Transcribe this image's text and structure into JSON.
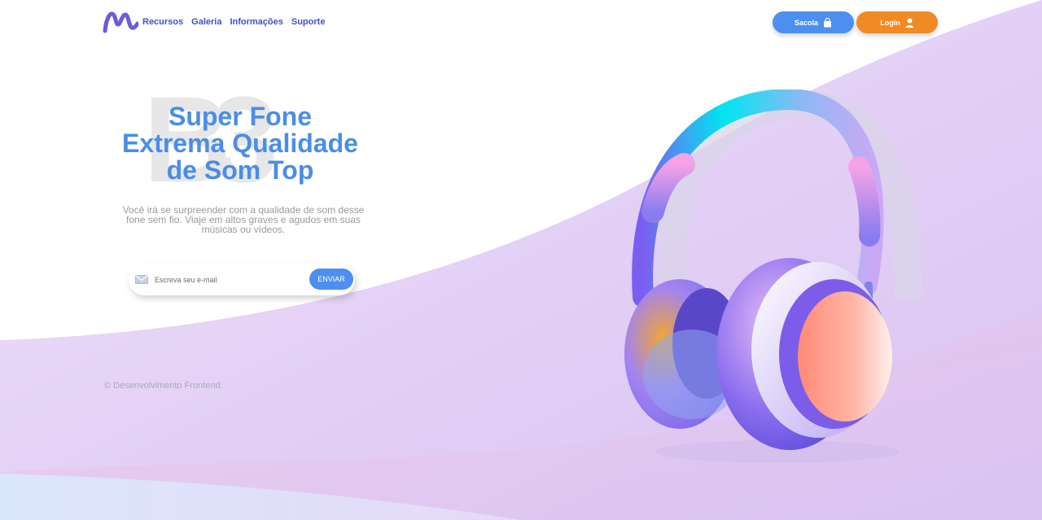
{
  "header": {
    "logo_label": "M",
    "nav": [
      {
        "label": "Recursos"
      },
      {
        "label": "Galeria"
      },
      {
        "label": "Informações"
      },
      {
        "label": "Suporte"
      }
    ],
    "bag_label": "Sacola",
    "login_label": "Login"
  },
  "hero": {
    "watermark": "B3",
    "title_lines": [
      "Super Fone",
      "Extrema Qualidade",
      "de Som Top"
    ],
    "description": "Você irá se surpreender com a qualidade de som desse fone sem fio. Viaje em altos graves e agudos em suas músicas ou vídeos."
  },
  "newsletter": {
    "placeholder": "Escreva seu e-mail",
    "value": "",
    "button_label": "ENVIAR"
  },
  "footer": {
    "text": "© Desenvolvimento Frontend."
  },
  "colors": {
    "accent_blue": "#4d8ff0",
    "accent_orange": "#f08a24",
    "title_blue": "#4a8de8",
    "wave_lilac": "#e3cff5",
    "wave_blue": "#d6e4fb"
  },
  "icons": {
    "bag": "shopping-bag-icon",
    "login": "user-icon",
    "mail": "envelope-icon"
  }
}
